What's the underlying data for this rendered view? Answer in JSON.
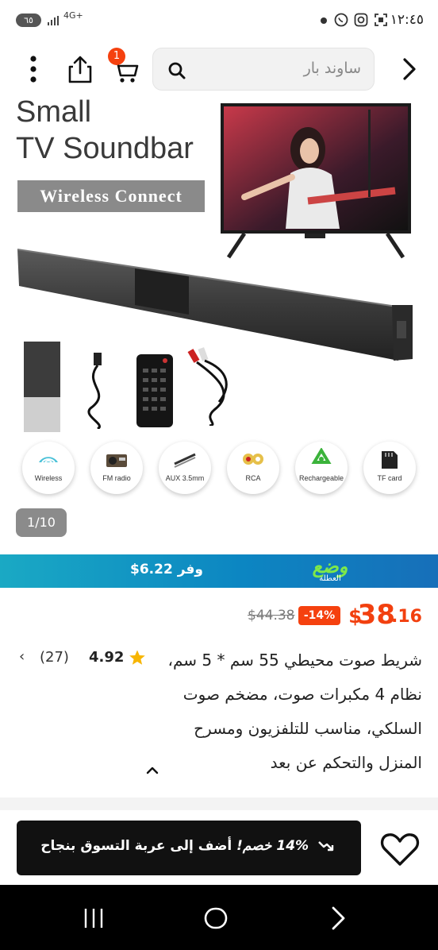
{
  "status_bar": {
    "time": "١٢:٤٥",
    "battery": "٦٥",
    "network": "4G+",
    "icons": [
      "screenshot-icon",
      "instagram-icon",
      "whatsapp-icon",
      "notification-dot-icon"
    ]
  },
  "header": {
    "search_placeholder": "ساوند بار",
    "cart_count": "1",
    "icons": [
      "back-arrow-icon",
      "search-icon",
      "cart-icon",
      "share-icon",
      "more-vertical-icon"
    ]
  },
  "gallery": {
    "headline_line1": "Small",
    "headline_line2": "TV Soundbar",
    "banner": "Wireless Connect",
    "features": [
      "Wireless",
      "FM radio",
      "AUX 3.5mm",
      "RCA",
      "Rechargeable",
      "TF card"
    ],
    "pager": "1/10"
  },
  "promo": {
    "save_text": "وفر 6.22$",
    "brand_top": "وضع",
    "brand_bottom": "العطلة"
  },
  "price": {
    "currency": "$",
    "integer": "38",
    "decimal": ".16",
    "discount": "-14%",
    "original": "$44.38"
  },
  "product": {
    "title": "شريط صوت محيطي 55 سم * 5 سم، نظام 4 مكبرات صوت، مضخم صوت السلكي، مناسب للتلفزيون ومسرح المنزل والتحكم عن بعد",
    "rating": "4.92",
    "reviews": "(27)"
  },
  "action": {
    "add_to_cart_prefix": "14% خصم!",
    "add_to_cart_label": "أضف إلى عربة التسوق بنجاح"
  },
  "colors": {
    "accent": "#f5410f",
    "promo_start": "#1aa9c4",
    "promo_end": "#176fb9",
    "button": "#111111"
  }
}
